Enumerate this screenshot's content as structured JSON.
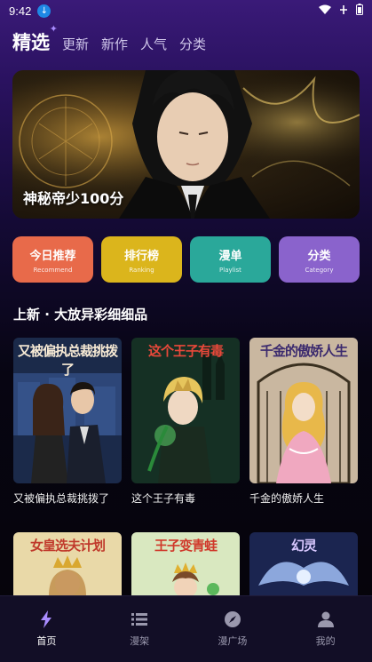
{
  "status": {
    "time": "9:42"
  },
  "tabs": [
    {
      "label": "精选"
    },
    {
      "label": "更新"
    },
    {
      "label": "新作"
    },
    {
      "label": "人气"
    },
    {
      "label": "分类"
    }
  ],
  "banner": {
    "title": "神秘帝少100分"
  },
  "categories": [
    {
      "label": "今日推荐",
      "sub": "Recommend",
      "color": "#e86a4a"
    },
    {
      "label": "排行榜",
      "sub": "Ranking",
      "color": "#dbb51c"
    },
    {
      "label": "漫单",
      "sub": "Playlist",
      "color": "#2aa89a"
    },
    {
      "label": "分类",
      "sub": "Category",
      "color": "#8a63cc"
    }
  ],
  "section": {
    "title": "上新 · 大放异彩细细品"
  },
  "comics": [
    {
      "name": "又被偏执总裁挑拨了",
      "cover_title": "又被偏执总裁挑拨了"
    },
    {
      "name": "这个王子有毒",
      "cover_title": "这个王子有毒"
    },
    {
      "name": "千金的傲娇人生",
      "cover_title": "千金的傲娇人生"
    }
  ],
  "comics_row2": [
    {
      "cover_title": "女皇选夫计划"
    },
    {
      "cover_title": "王子变青蛙"
    },
    {
      "cover_title": "幻灵"
    }
  ],
  "nav": [
    {
      "label": "首页",
      "icon": "lightning-icon"
    },
    {
      "label": "漫架",
      "icon": "list-icon"
    },
    {
      "label": "漫广场",
      "icon": "compass-icon"
    },
    {
      "label": "我的",
      "icon": "person-icon"
    }
  ],
  "colors": {
    "accent": "#a98cff",
    "nav_bg": "#120e26"
  }
}
